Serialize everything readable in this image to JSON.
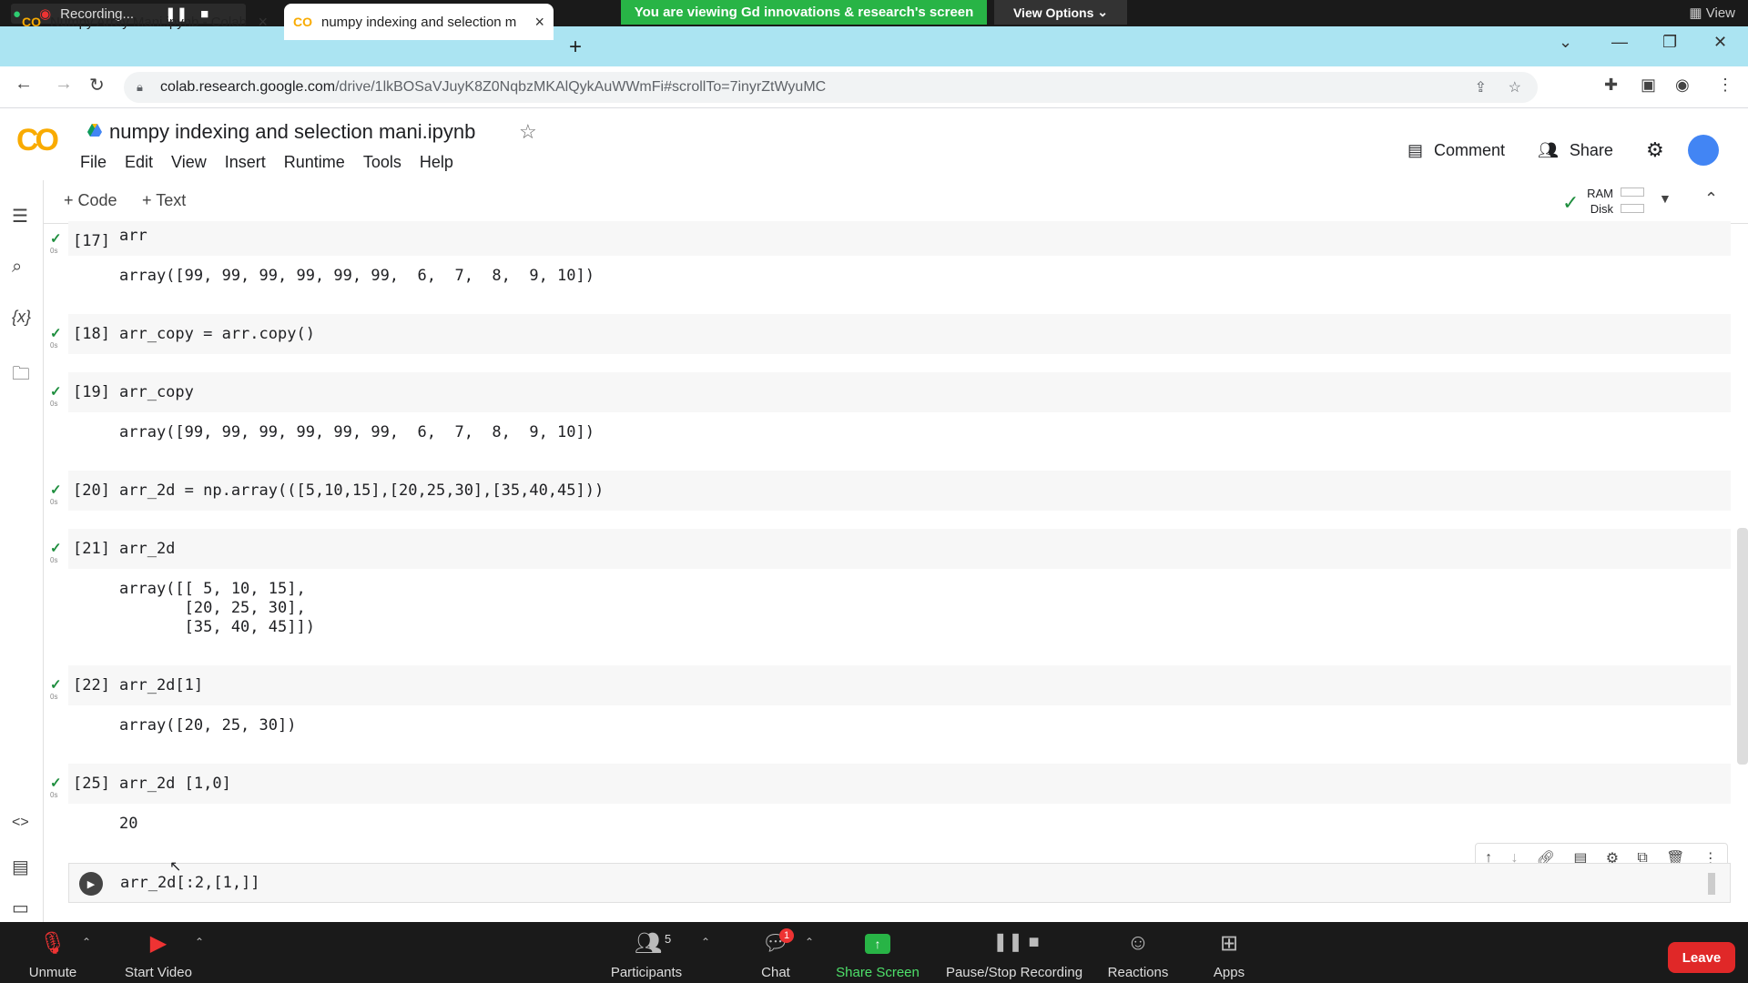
{
  "zoom_top": {
    "recording": "Recording...",
    "banner": "You are viewing Gd innovations & research's screen",
    "view_options": "View Options",
    "view": "View"
  },
  "tabs": [
    {
      "title": "Numpy Array Mani.ipynb - Colab"
    },
    {
      "title": "numpy indexing and selection m"
    }
  ],
  "address": {
    "host": "colab.research.google.com",
    "path": "/drive/1lkBOSaVJuyK8Z0NqbzMKAlQykAuWWmFi#scrollTo=7inyrZtWyuMC"
  },
  "colab": {
    "logo": "CO",
    "title": "numpy indexing and selection mani.ipynb",
    "menu": [
      "File",
      "Edit",
      "View",
      "Insert",
      "Runtime",
      "Tools",
      "Help"
    ],
    "comment": "Comment",
    "share": "Share",
    "add_code": "+ Code",
    "add_text": "+ Text",
    "ram": "RAM",
    "disk": "Disk"
  },
  "cells": [
    {
      "label": "[17]",
      "code": "arr",
      "time": "0s",
      "output": "array([99, 99, 99, 99, 99, 99,  6,  7,  8,  9, 10])"
    },
    {
      "label": "[18]",
      "code": "arr_copy = arr.copy()",
      "time": "0s",
      "output": ""
    },
    {
      "label": "[19]",
      "code": "arr_copy",
      "time": "0s",
      "output": "array([99, 99, 99, 99, 99, 99,  6,  7,  8,  9, 10])"
    },
    {
      "label": "[20]",
      "code": "arr_2d = np.array(([5,10,15],[20,25,30],[35,40,45]))",
      "time": "0s",
      "output": ""
    },
    {
      "label": "[21]",
      "code": "arr_2d",
      "time": "0s",
      "output": "array([[ 5, 10, 15],\n       [20, 25, 30],\n       [35, 40, 45]])"
    },
    {
      "label": "[22]",
      "code": "arr_2d[1]",
      "time": "0s",
      "output": "array([20, 25, 30])"
    },
    {
      "label": "[25]",
      "code": "arr_2d [1,0]",
      "time": "0s",
      "output": "20"
    }
  ],
  "active_cell": {
    "code": "arr_2d[:2,[1,]]"
  },
  "zoom_bottom": {
    "unmute": "Unmute",
    "start_video": "Start Video",
    "participants": "Participants",
    "participants_count": "5",
    "chat": "Chat",
    "chat_badge": "1",
    "share_screen": "Share Screen",
    "pause_stop": "Pause/Stop Recording",
    "reactions": "Reactions",
    "apps": "Apps",
    "leave": "Leave"
  }
}
